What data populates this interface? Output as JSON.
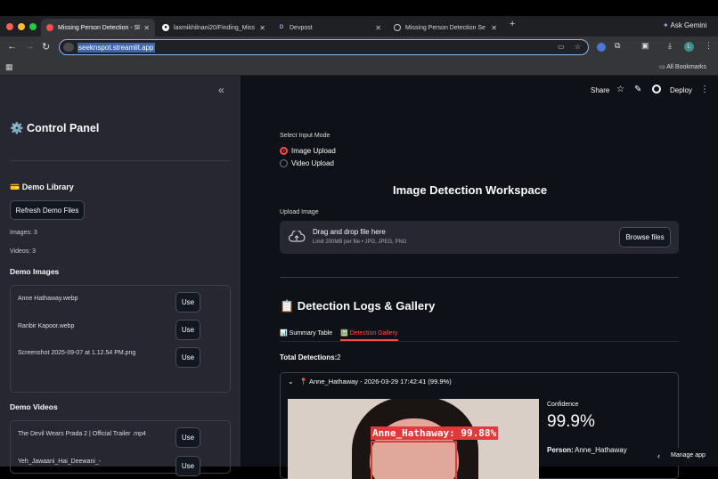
{
  "browser": {
    "tabs": [
      {
        "title": "Missing Person Detection - Sl",
        "icon": "streamlit-icon",
        "active": true
      },
      {
        "title": "laxmikhilnani20/Finding_Miss",
        "icon": "github-icon",
        "active": false
      },
      {
        "title": "Devpost",
        "icon": "devpost-icon",
        "active": false
      },
      {
        "title": "Missing Person Detection Se",
        "icon": "globe-icon",
        "active": false
      }
    ],
    "new_tab": "+",
    "ask_gemini": "Ask Gemini",
    "url": "seeknspot.streamlit.app",
    "profile_initial": "L",
    "bookmarks_label": "All Bookmarks"
  },
  "header": {
    "share": "Share",
    "deploy": "Deploy"
  },
  "sidebar": {
    "collapse": "«",
    "title": "⚙️ Control Panel",
    "demo_library": "💳 Demo Library",
    "refresh_button": "Refresh Demo Files",
    "images_count": "Images: 3",
    "videos_count": "Videos: 3",
    "demo_images_heading": "Demo Images",
    "demo_images": [
      {
        "name": "Anne Hathaway.webp",
        "action": "Use"
      },
      {
        "name": "Ranbir Kapoor.webp",
        "action": "Use"
      },
      {
        "name": "Screenshot 2025-09-07 at 1.12.54 PM.png",
        "action": "Use"
      }
    ],
    "demo_videos_heading": "Demo Videos",
    "demo_videos": [
      {
        "name": "The Devil Wears Prada 2 | Official Trailer .mp4",
        "action": "Use"
      },
      {
        "name": "Yeh_Jawaani_Hai_Deewani_-",
        "action": "Use"
      }
    ]
  },
  "main": {
    "input_mode_label": "Select Input Mode",
    "input_modes": [
      {
        "label": "Image Upload",
        "selected": true
      },
      {
        "label": "Video Upload",
        "selected": false
      }
    ],
    "workspace_title": "Image Detection Workspace",
    "upload_label": "Upload Image",
    "dropzone_title": "Drag and drop file here",
    "dropzone_hint": "Limit 200MB per file • JPG, JPEG, PNG",
    "browse_button": "Browse files",
    "logs_title": "📋 Detection Logs & Gallery",
    "tabs": [
      {
        "label": "📊 Summary Table",
        "active": false
      },
      {
        "label": "🖼️ Detection Gallery",
        "active": true
      }
    ],
    "total_label": "Total Detections:",
    "total_value": "2",
    "expander_title": "📍 Anne_Hathaway - 2026-03-29 17:42:41 (99.9%)",
    "bbox_label": "Anne_Hathaway: 99.88%",
    "confidence_label": "Confidence",
    "confidence_value": "99.9%",
    "person_label": "Person:",
    "person_value": "Anne_Hathaway",
    "manage_app": "Manage app"
  },
  "colors": {
    "accent": "#ff4b4b",
    "sidebar_bg": "#262730",
    "main_bg": "#0e1117"
  }
}
